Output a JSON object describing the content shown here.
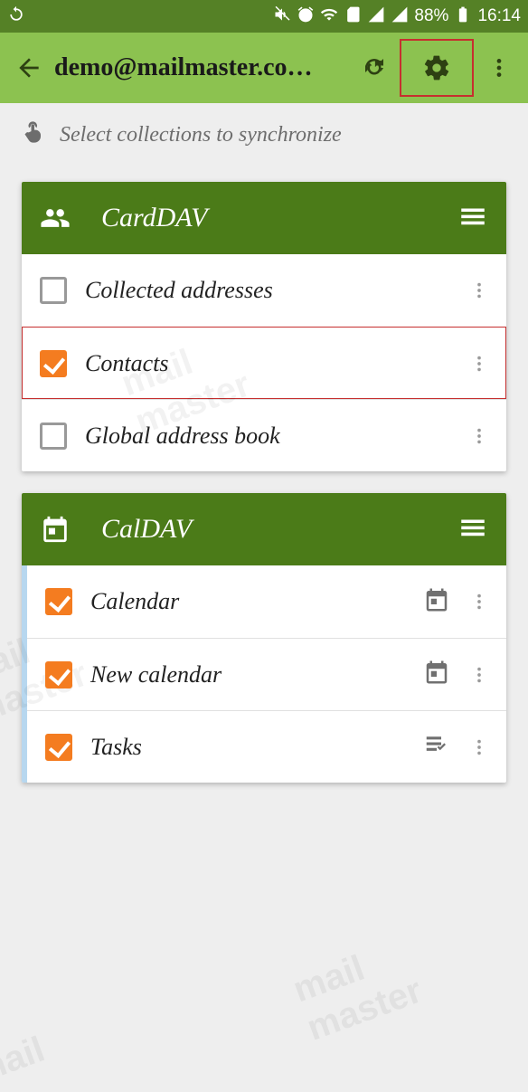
{
  "status": {
    "battery": "88%",
    "time": "16:14"
  },
  "appbar": {
    "title": "demo@mailmaster.co…"
  },
  "hint": "Select collections to synchronize",
  "carddav": {
    "title": "CardDAV",
    "items": [
      {
        "label": "Collected addresses",
        "checked": false,
        "highlighted": false
      },
      {
        "label": "Contacts",
        "checked": true,
        "highlighted": true
      },
      {
        "label": "Global address book",
        "checked": false,
        "highlighted": false
      }
    ]
  },
  "caldav": {
    "title": "CalDAV",
    "items": [
      {
        "label": "Calendar",
        "checked": true,
        "icon": "calendar"
      },
      {
        "label": "New calendar",
        "checked": true,
        "icon": "calendar"
      },
      {
        "label": "Tasks",
        "checked": true,
        "icon": "tasks"
      }
    ]
  }
}
